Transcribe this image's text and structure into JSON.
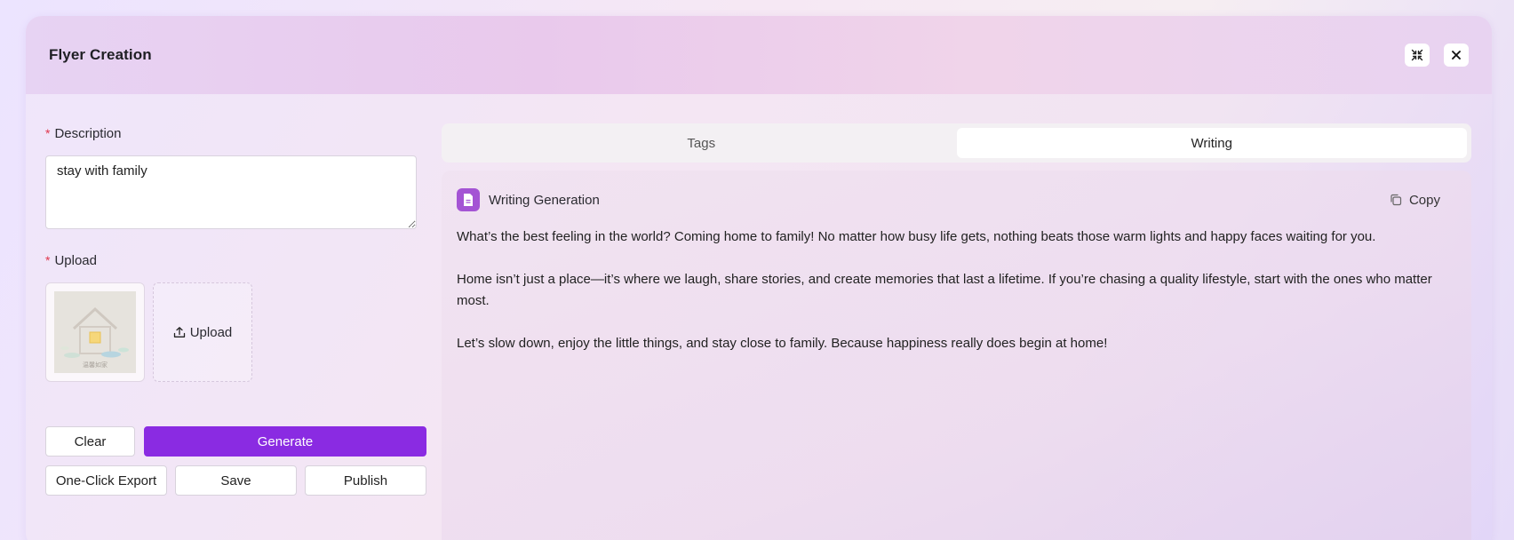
{
  "window": {
    "title": "Flyer Creation"
  },
  "form": {
    "description_label": "Description",
    "description_value": "stay with family",
    "upload_label": "Upload",
    "upload_button": "Upload",
    "thumbnail_caption": "温馨如家"
  },
  "actions": {
    "clear": "Clear",
    "generate": "Generate",
    "export": "One-Click Export",
    "save": "Save",
    "publish": "Publish"
  },
  "tabs": [
    {
      "label": "Tags",
      "active": false
    },
    {
      "label": "Writing",
      "active": true
    }
  ],
  "panel": {
    "title": "Writing Generation",
    "copy_label": "Copy",
    "paragraphs": [
      "What’s the best feeling in the world? Coming home to family! No matter how busy life gets, nothing beats those warm lights and happy faces waiting for you.",
      "Home isn’t just a place—it’s where we laugh, share stories, and create memories that last a lifetime. If you’re chasing a quality lifestyle, start with the ones who matter most.",
      "Let’s slow down, enjoy the little things, and stay close to family. Because happiness really does begin at home!"
    ]
  },
  "colors": {
    "accent": "#8a2be2",
    "required": "#e0364c",
    "doc_icon": "#a454d4"
  },
  "icons": {
    "minimize": "collapse-arrows-icon",
    "close": "close-icon",
    "upload": "upload-icon",
    "document": "document-icon",
    "copy": "copy-icon"
  }
}
